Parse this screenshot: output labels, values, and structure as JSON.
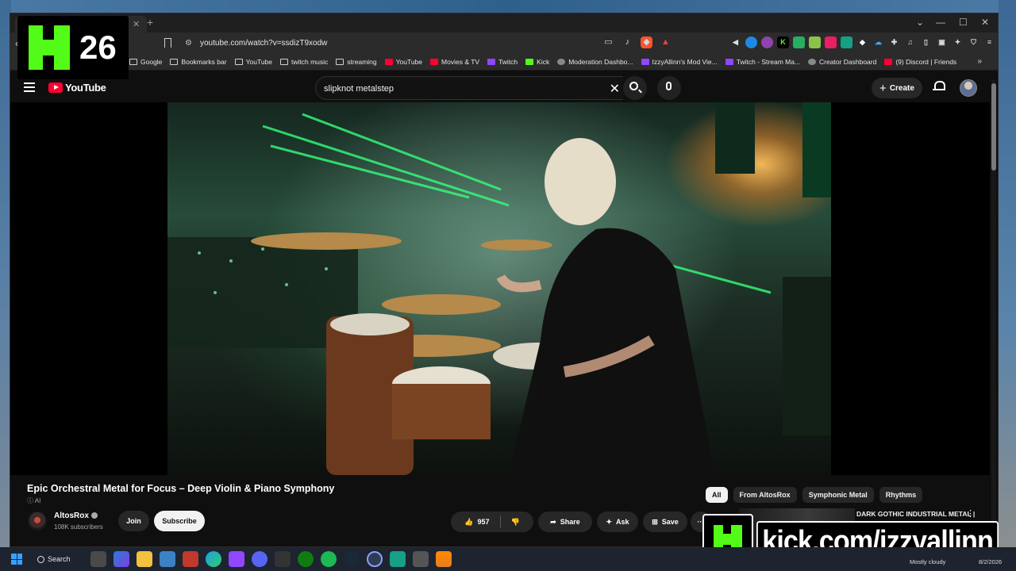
{
  "browser": {
    "url": "youtube.com/watch?v=ssdizT9xodw",
    "window_controls": [
      "⌄",
      "—",
      "☐",
      "✕"
    ],
    "bookmarks": [
      {
        "label": "Google",
        "icon": "bookmark-folder-icon",
        "style": ""
      },
      {
        "label": "Bookmarks bar",
        "icon": "folder-icon",
        "style": ""
      },
      {
        "label": "YouTube",
        "icon": "folder-icon",
        "style": ""
      },
      {
        "label": "twitch music",
        "icon": "folder-icon",
        "style": ""
      },
      {
        "label": "streaming",
        "icon": "folder-icon",
        "style": ""
      },
      {
        "label": "YouTube",
        "icon": "youtube-icon",
        "style": "red"
      },
      {
        "label": "Movies & TV",
        "icon": "youtube-icon",
        "style": "red"
      },
      {
        "label": "Twitch",
        "icon": "twitch-icon",
        "style": "purple"
      },
      {
        "label": "Kick",
        "icon": "kick-icon",
        "style": "green"
      },
      {
        "label": "Moderation Dashbo...",
        "icon": "globe-icon",
        "style": "grey"
      },
      {
        "label": "IzzyAllinn's Mod Vie...",
        "icon": "twitch-icon",
        "style": "purple"
      },
      {
        "label": "Twitch - Stream Ma...",
        "icon": "twitch-icon",
        "style": "purple"
      },
      {
        "label": "Creator Dashboard",
        "icon": "globe-icon",
        "style": "grey"
      },
      {
        "label": "(9) Discord | Friends",
        "icon": "discord-icon",
        "style": "red"
      }
    ]
  },
  "youtube": {
    "logo_text": "YouTube",
    "search_query": "slipknot metalstep",
    "create_label": "Create",
    "video": {
      "title": "Epic Orchestral Metal for Focus – Deep Violin & Piano Symphony",
      "ai_label": "AI",
      "channel_name": "AltosRox",
      "subscribers": "108K subscribers",
      "join_label": "Join",
      "subscribe_label": "Subscribe",
      "likes": "957",
      "share_label": "Share",
      "ask_label": "Ask",
      "save_label": "Save"
    },
    "chips": [
      "All",
      "From AltosRox",
      "Symphonic Metal",
      "Rhythms"
    ],
    "recommendation_title": "DARK GOTHIC INDUSTRIAL METAL | Female Vocal Rock"
  },
  "overlay": {
    "badge_number": "26",
    "kick_url": "kick.com/izzyallinn"
  },
  "taskbar": {
    "search_label": "Search",
    "weather": "Mostly cloudy",
    "date": "8/2/2026"
  },
  "colors": {
    "youtube_red": "#ff0033",
    "kick_green": "#53fc18",
    "twitch_purple": "#9146ff"
  }
}
